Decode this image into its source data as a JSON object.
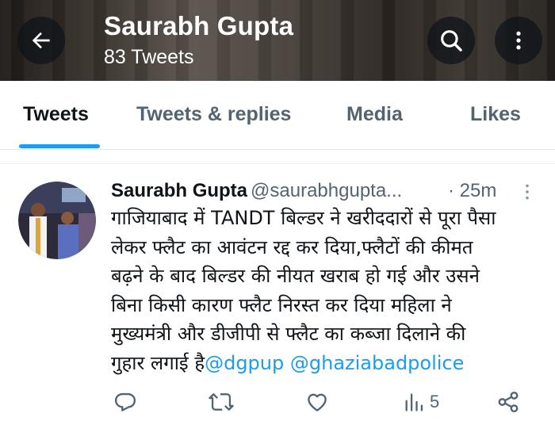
{
  "header": {
    "title": "Saurabh Gupta",
    "subtitle": "83 Tweets"
  },
  "tabs": [
    {
      "label": "Tweets",
      "active": true
    },
    {
      "label": "Tweets & replies",
      "active": false
    },
    {
      "label": "Media",
      "active": false
    },
    {
      "label": "Likes",
      "active": false
    }
  ],
  "tweet": {
    "name": "Saurabh Gupta",
    "handle": "@saurabhgupta...",
    "time": "· 25m",
    "lines": [
      "गाजियाबाद में TANDT बिल्डर ने खरीददारों से पूरा पैसा",
      "लेकर फ्लैट का आवंटन रद्द कर दिया,फ्लैटों की कीमत",
      "बढ़ने के बाद बिल्डर की नीयत खराब हो गई और उसने",
      "बिना किसी कारण फ्लैट निरस्त कर दिया महिला ने",
      "मुख्यमंत्री और डीजीपी से फ्लैट का कब्जा दिलाने की"
    ],
    "last_line_text": "गुहार लगाई है",
    "mentions": [
      "@dgpup",
      "@ghaziabadpolice"
    ],
    "views_count": "5"
  },
  "icons": {
    "back": "arrow-left-icon",
    "search": "search-icon",
    "more": "more-vertical-icon",
    "reply": "reply-icon",
    "retweet": "retweet-icon",
    "like": "heart-icon",
    "views": "analytics-icon",
    "share": "share-icon"
  },
  "colors": {
    "accent": "#1d9bf0",
    "text": "#0f1419",
    "secondary": "#536471"
  }
}
